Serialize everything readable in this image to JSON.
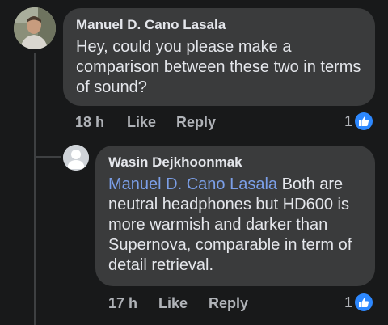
{
  "comment": {
    "author": "Manuel D. Cano Lasala",
    "text": "Hey, could you please make a comparison between these two in terms of sound?",
    "time": "18 h",
    "like_label": "Like",
    "reply_label": "Reply",
    "reaction_count": "1"
  },
  "reply": {
    "author": "Wasin Dejkhoonmak",
    "mention": "Manuel D. Cano Lasala",
    "text": " Both are neutral headphones but HD600 is more warmish and darker than Supernova, comparable in term of detail retrieval.",
    "time": "17 h",
    "like_label": "Like",
    "reply_label": "Reply",
    "reaction_count": "1"
  },
  "colors": {
    "background": "#18191a",
    "bubble": "#3a3b3c",
    "mention": "#7b9fe8",
    "like": "#2d88ff"
  }
}
